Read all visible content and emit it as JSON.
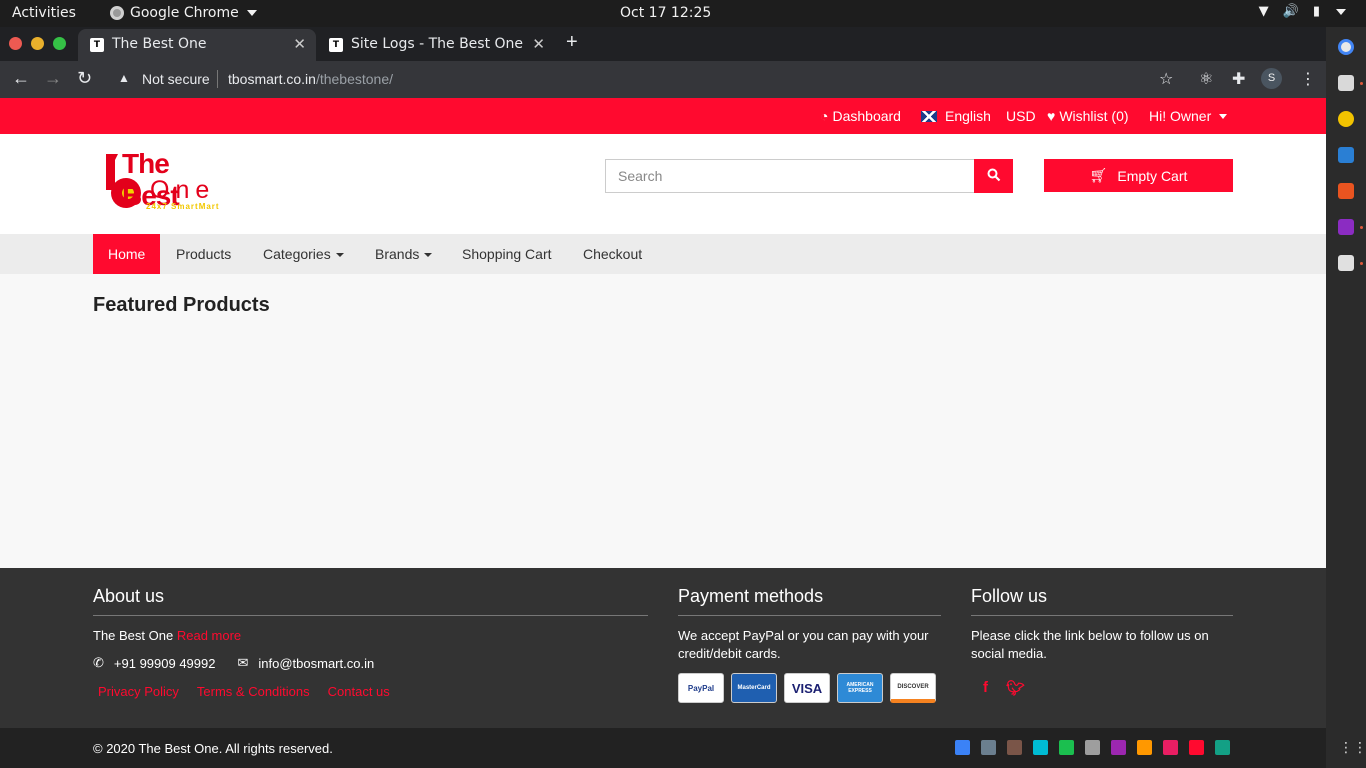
{
  "system_bar": {
    "activities": "Activities",
    "app_name": "Google Chrome",
    "clock": "Oct 17  12:25"
  },
  "browser": {
    "tabs": [
      {
        "favicon": "T",
        "title": "The Best One",
        "active": true
      },
      {
        "favicon": "T",
        "title": "Site Logs - The Best One",
        "active": false
      }
    ],
    "security_label": "Not secure",
    "url_host": "tbosmart.co.in",
    "url_path": "/thebestone/",
    "profile_initial": "S"
  },
  "topbar": {
    "dashboard": "Dashboard",
    "language": "English",
    "currency": "USD",
    "wishlist": "Wishlist (0)",
    "user": "Hi! Owner"
  },
  "logo": {
    "line1": "The Best",
    "line2": "One",
    "tagline": "24x7 SmartMart"
  },
  "search": {
    "placeholder": "Search"
  },
  "cart": {
    "label": "Empty Cart"
  },
  "nav": {
    "home": "Home",
    "products": "Products",
    "categories": "Categories",
    "brands": "Brands",
    "shopping_cart": "Shopping Cart",
    "checkout": "Checkout"
  },
  "main": {
    "heading": "Featured Products"
  },
  "footer": {
    "about": {
      "title": "About us",
      "text": "The Best One",
      "read_more": "Read more",
      "phone": "+91 99909 49992",
      "email": "info@tbosmart.co.in",
      "links": [
        "Privacy Policy",
        "Terms & Conditions",
        "Contact us"
      ]
    },
    "payment": {
      "title": "Payment methods",
      "text": "We accept PayPal or you can pay with your credit/debit cards.",
      "cards": [
        "PayPal",
        "MasterCard",
        "VISA",
        "AMERICAN EXPRESS",
        "DISCOVER"
      ]
    },
    "follow": {
      "title": "Follow us",
      "text": "Please click the link below to follow us on social media."
    },
    "copyright": "© 2020 The Best One. All rights reserved.",
    "theme_colors": [
      "#3b82f6",
      "#6b7f8f",
      "#7a5548",
      "#00bcd4",
      "#1bbf4f",
      "#9e9e9e",
      "#9c27b0",
      "#ff9800",
      "#e91e63",
      "#ff0a2f",
      "#13a085"
    ]
  },
  "colors": {
    "brand_red": "#ff0a2f",
    "footer_bg": "#333333"
  }
}
